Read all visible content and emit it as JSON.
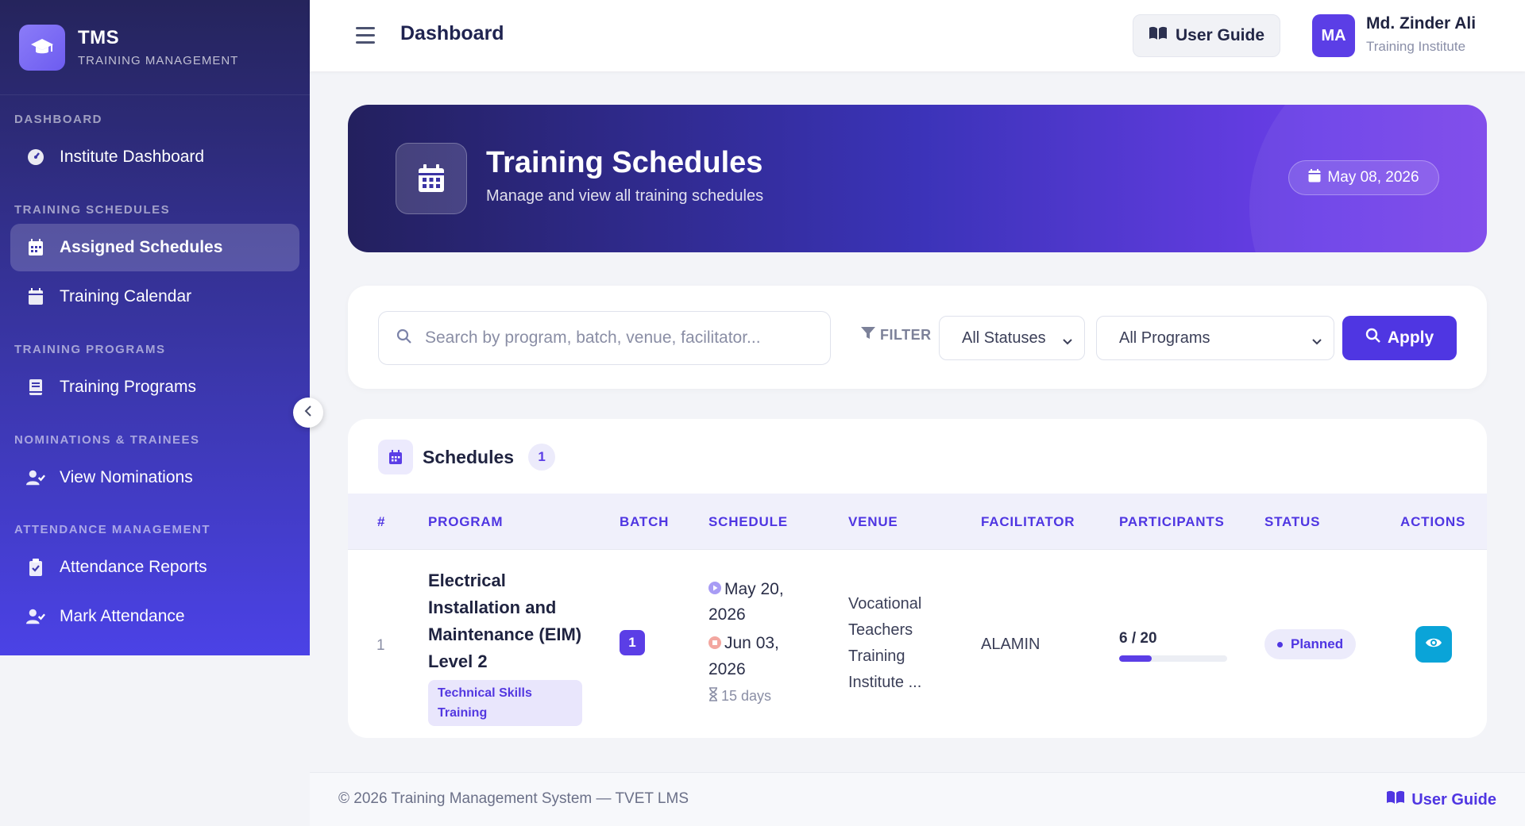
{
  "brand": {
    "title": "TMS",
    "subtitle": "TRAINING MANAGEMENT"
  },
  "sidebar": {
    "sections": [
      {
        "label": "DASHBOARD"
      },
      {
        "label": "TRAINING SCHEDULES"
      },
      {
        "label": "TRAINING PROGRAMS"
      },
      {
        "label": "NOMINATIONS & TRAINEES"
      },
      {
        "label": "ATTENDANCE MANAGEMENT"
      }
    ],
    "items": [
      {
        "label": "Institute Dashboard",
        "icon": "gauge-icon"
      },
      {
        "label": "Assigned Schedules",
        "icon": "calendar-icon",
        "active": true
      },
      {
        "label": "Training Calendar",
        "icon": "calendar-icon"
      },
      {
        "label": "Training Programs",
        "icon": "book-icon"
      },
      {
        "label": "View Nominations",
        "icon": "user-check-icon"
      },
      {
        "label": "Attendance Reports",
        "icon": "clipboard-check-icon"
      },
      {
        "label": "Mark Attendance",
        "icon": "user-check-icon"
      }
    ]
  },
  "topbar": {
    "title": "Dashboard",
    "guide_label": "User Guide",
    "user": {
      "initials": "MA",
      "name": "Md. Zinder Ali",
      "role": "Training Institute"
    }
  },
  "hero": {
    "title": "Training Schedules",
    "subtitle": "Manage and view all training schedules",
    "date": "May 08, 2026"
  },
  "filters": {
    "search_placeholder": "Search by program, batch, venue, facilitator...",
    "filter_label": "FILTER",
    "status_selected": "All Statuses",
    "program_selected": "All Programs",
    "apply_label": "Apply"
  },
  "table": {
    "title": "Schedules",
    "count": "1",
    "columns": [
      "#",
      "PROGRAM",
      "BATCH",
      "SCHEDULE",
      "VENUE",
      "FACILITATOR",
      "PARTICIPANTS",
      "STATUS",
      "ACTIONS"
    ],
    "rows": [
      {
        "index": "1",
        "program_name": "Electrical Installation and Maintenance (EIM) Level 2",
        "program_tag": "Technical Skills Training",
        "batch": "1",
        "start_date": "May 20, 2026",
        "end_date": "Jun 03, 2026",
        "duration": "15 days",
        "venue": "Vocational Teachers Training Institute ...",
        "facilitator": "ALAMIN",
        "participants": "6 / 20",
        "participants_fraction": 0.3,
        "status": "Planned"
      }
    ]
  },
  "footer": {
    "text": "© 2026 Training Management System — TVET LMS",
    "link": "User Guide"
  },
  "colors": {
    "accent": "#4f36e2",
    "sidebar_top": "#25245c",
    "sidebar_bottom": "#4b42e6",
    "view_button": "#0aa4d8"
  }
}
